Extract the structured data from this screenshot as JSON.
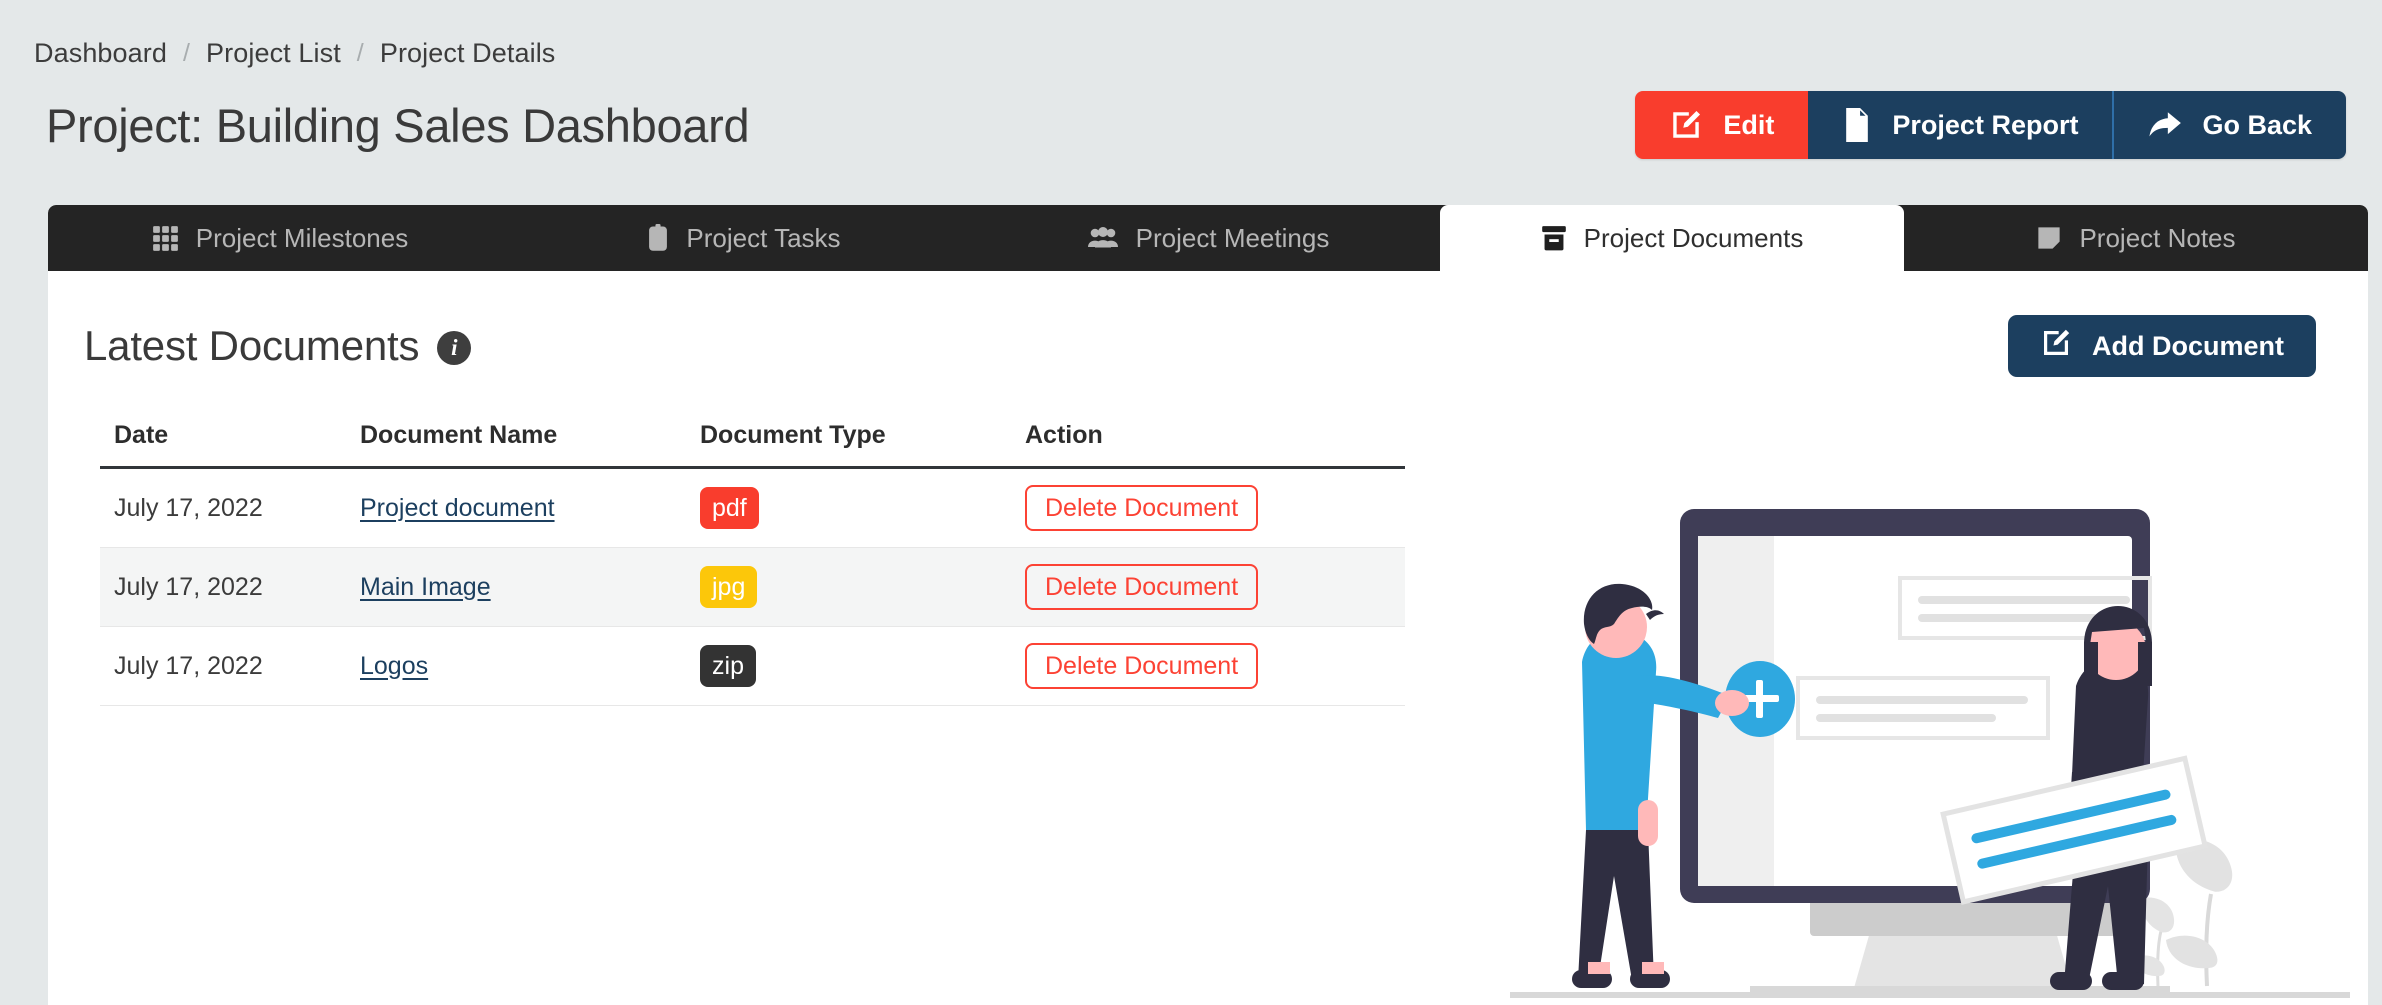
{
  "breadcrumb": {
    "separator": "/",
    "items": [
      {
        "label": "Dashboard"
      },
      {
        "label": "Project List"
      },
      {
        "label": "Project Details"
      }
    ]
  },
  "header": {
    "title": "Project: Building Sales Dashboard",
    "actions": [
      {
        "label": "Edit",
        "icon": "edit-pencil-icon",
        "color": "#f93d2d"
      },
      {
        "label": "Project Report",
        "icon": "document-icon",
        "color": "#1c3f5f"
      },
      {
        "label": "Go Back",
        "icon": "arrow-reply-icon",
        "color": "#1c3f5f"
      }
    ]
  },
  "tabs": [
    {
      "label": "Project Milestones",
      "icon": "grid-icon",
      "active": false
    },
    {
      "label": "Project Tasks",
      "icon": "clipboard-icon",
      "active": false
    },
    {
      "label": "Project Meetings",
      "icon": "people-icon",
      "active": false
    },
    {
      "label": "Project Documents",
      "icon": "archive-box-icon",
      "active": true
    },
    {
      "label": "Project Notes",
      "icon": "sticky-note-icon",
      "active": false
    }
  ],
  "section": {
    "title": "Latest Documents",
    "info_icon": "info-icon",
    "info_glyph": "i",
    "add_button": {
      "label": "Add Document",
      "icon": "edit-pencil-icon"
    }
  },
  "table": {
    "columns": [
      "Date",
      "Document Name",
      "Document Type",
      "Action"
    ],
    "rows": [
      {
        "date": "July 17, 2022",
        "name": "Project document",
        "type": "pdf",
        "type_color": "#f93d2d",
        "action": "Delete Document"
      },
      {
        "date": "July 17, 2022",
        "name": "Main Image",
        "type": "jpg",
        "type_color": "#fcc70a",
        "action": "Delete Document"
      },
      {
        "date": "July 17, 2022",
        "name": "Logos",
        "type": "zip",
        "type_color": "#333333",
        "action": "Delete Document"
      }
    ]
  },
  "illustration": {
    "name": "people-adding-content-illustration",
    "colors": {
      "monitor_frame": "#3f3d56",
      "monitor_stand": "#cccccc",
      "accent_blue": "#2fa8e0",
      "skin": "#ffb9b9",
      "dark_clothes": "#2f2e41",
      "light_grey": "#e6e6e6"
    }
  },
  "theme": {
    "page_background": "#e4e8e9",
    "card_background": "#ffffff",
    "tabbar_background": "#242424",
    "navy": "#1c3f5f",
    "red": "#f93d2d",
    "yellow": "#fcc70a"
  }
}
